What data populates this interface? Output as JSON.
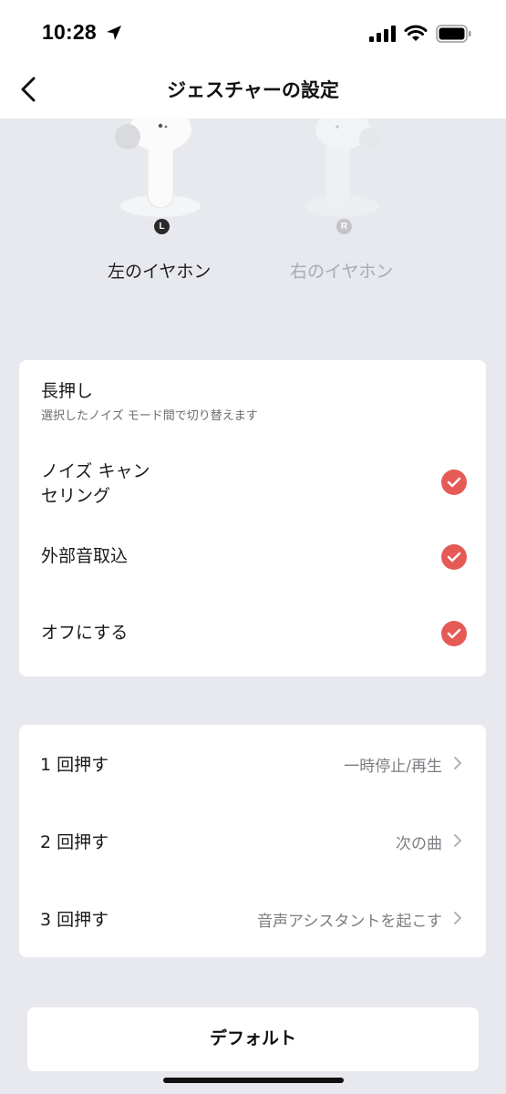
{
  "status_bar": {
    "time": "10:28"
  },
  "nav": {
    "title": "ジェスチャーの設定"
  },
  "earbuds": {
    "left": {
      "badge": "L",
      "label": "左のイヤホン"
    },
    "right": {
      "badge": "R",
      "label": "右のイヤホン"
    }
  },
  "long_press": {
    "title": "長押し",
    "subtitle": "選択したノイズ モード間で切り替えます",
    "modes": [
      {
        "label_line1": "ノイズ キャン",
        "label_line2": "セリング",
        "checked": true
      },
      {
        "label": "外部音取込",
        "checked": true
      },
      {
        "label": "オフにする",
        "checked": true
      }
    ]
  },
  "press_actions": [
    {
      "label": "1 回押す",
      "value": "一時停止/再生"
    },
    {
      "label": "2 回押す",
      "value": "次の曲"
    },
    {
      "label": "3 回押す",
      "value": "音声アシスタントを起こす"
    }
  ],
  "default_button": {
    "label": "デフォルト"
  },
  "colors": {
    "accent": "#e65a56",
    "background": "#e8e9ee",
    "card": "#ffffff"
  }
}
